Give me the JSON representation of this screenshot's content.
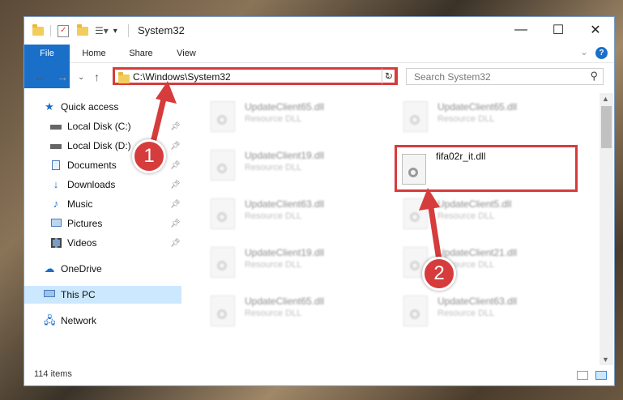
{
  "window": {
    "title": "System32",
    "controls": {
      "minimize": "—",
      "maximize": "☐",
      "close": "✕"
    }
  },
  "ribbon": {
    "tabs": [
      "File",
      "Home",
      "Share",
      "View"
    ],
    "help": "?"
  },
  "address": {
    "path": "C:\\Windows\\System32",
    "search_placeholder": "Search System32"
  },
  "sidebar": {
    "items": [
      {
        "label": "Quick access",
        "icon": "star-icon",
        "pinned": false
      },
      {
        "label": "Local Disk (C:)",
        "icon": "drive-icon",
        "pinned": true
      },
      {
        "label": "Local Disk (D:)",
        "icon": "drive-icon",
        "pinned": true
      },
      {
        "label": "Documents",
        "icon": "documents-icon",
        "pinned": true
      },
      {
        "label": "Downloads",
        "icon": "download-icon",
        "pinned": true
      },
      {
        "label": "Music",
        "icon": "music-icon",
        "pinned": true
      },
      {
        "label": "Pictures",
        "icon": "pictures-icon",
        "pinned": true
      },
      {
        "label": "Videos",
        "icon": "videos-icon",
        "pinned": true
      },
      {
        "label": "OneDrive",
        "icon": "cloud-icon",
        "pinned": false
      },
      {
        "label": "This PC",
        "icon": "computer-icon",
        "pinned": false
      },
      {
        "label": "Network",
        "icon": "network-icon",
        "pinned": false
      }
    ]
  },
  "files": [
    {
      "name": "UpdateClient65.dll",
      "type": "Resource DLL"
    },
    {
      "name": "UpdateClient65.dll",
      "type": "Resource DLL"
    },
    {
      "name": "UpdateClient19.dll",
      "type": "Resource DLL"
    },
    {
      "name": "UpdateClient63.dll",
      "type": "Resource DLL"
    },
    {
      "name": "UpdateClient5.dll",
      "type": "Resource DLL"
    },
    {
      "name": "UpdateClient19.dll",
      "type": "Resource DLL"
    },
    {
      "name": "UpdateClient21.dll",
      "type": "Resource DLL"
    },
    {
      "name": "UpdateClient65.dll",
      "type": "Resource DLL"
    },
    {
      "name": "UpdateClient63.dll",
      "type": "Resource DLL"
    }
  ],
  "highlighted_file": {
    "name": "fifa02r_it.dll"
  },
  "status": {
    "item_count": "114 items"
  },
  "callouts": {
    "one": "1",
    "two": "2"
  },
  "colors": {
    "accent": "#1a6fc9",
    "highlight": "#d63c3c",
    "selection": "#cce8ff"
  }
}
